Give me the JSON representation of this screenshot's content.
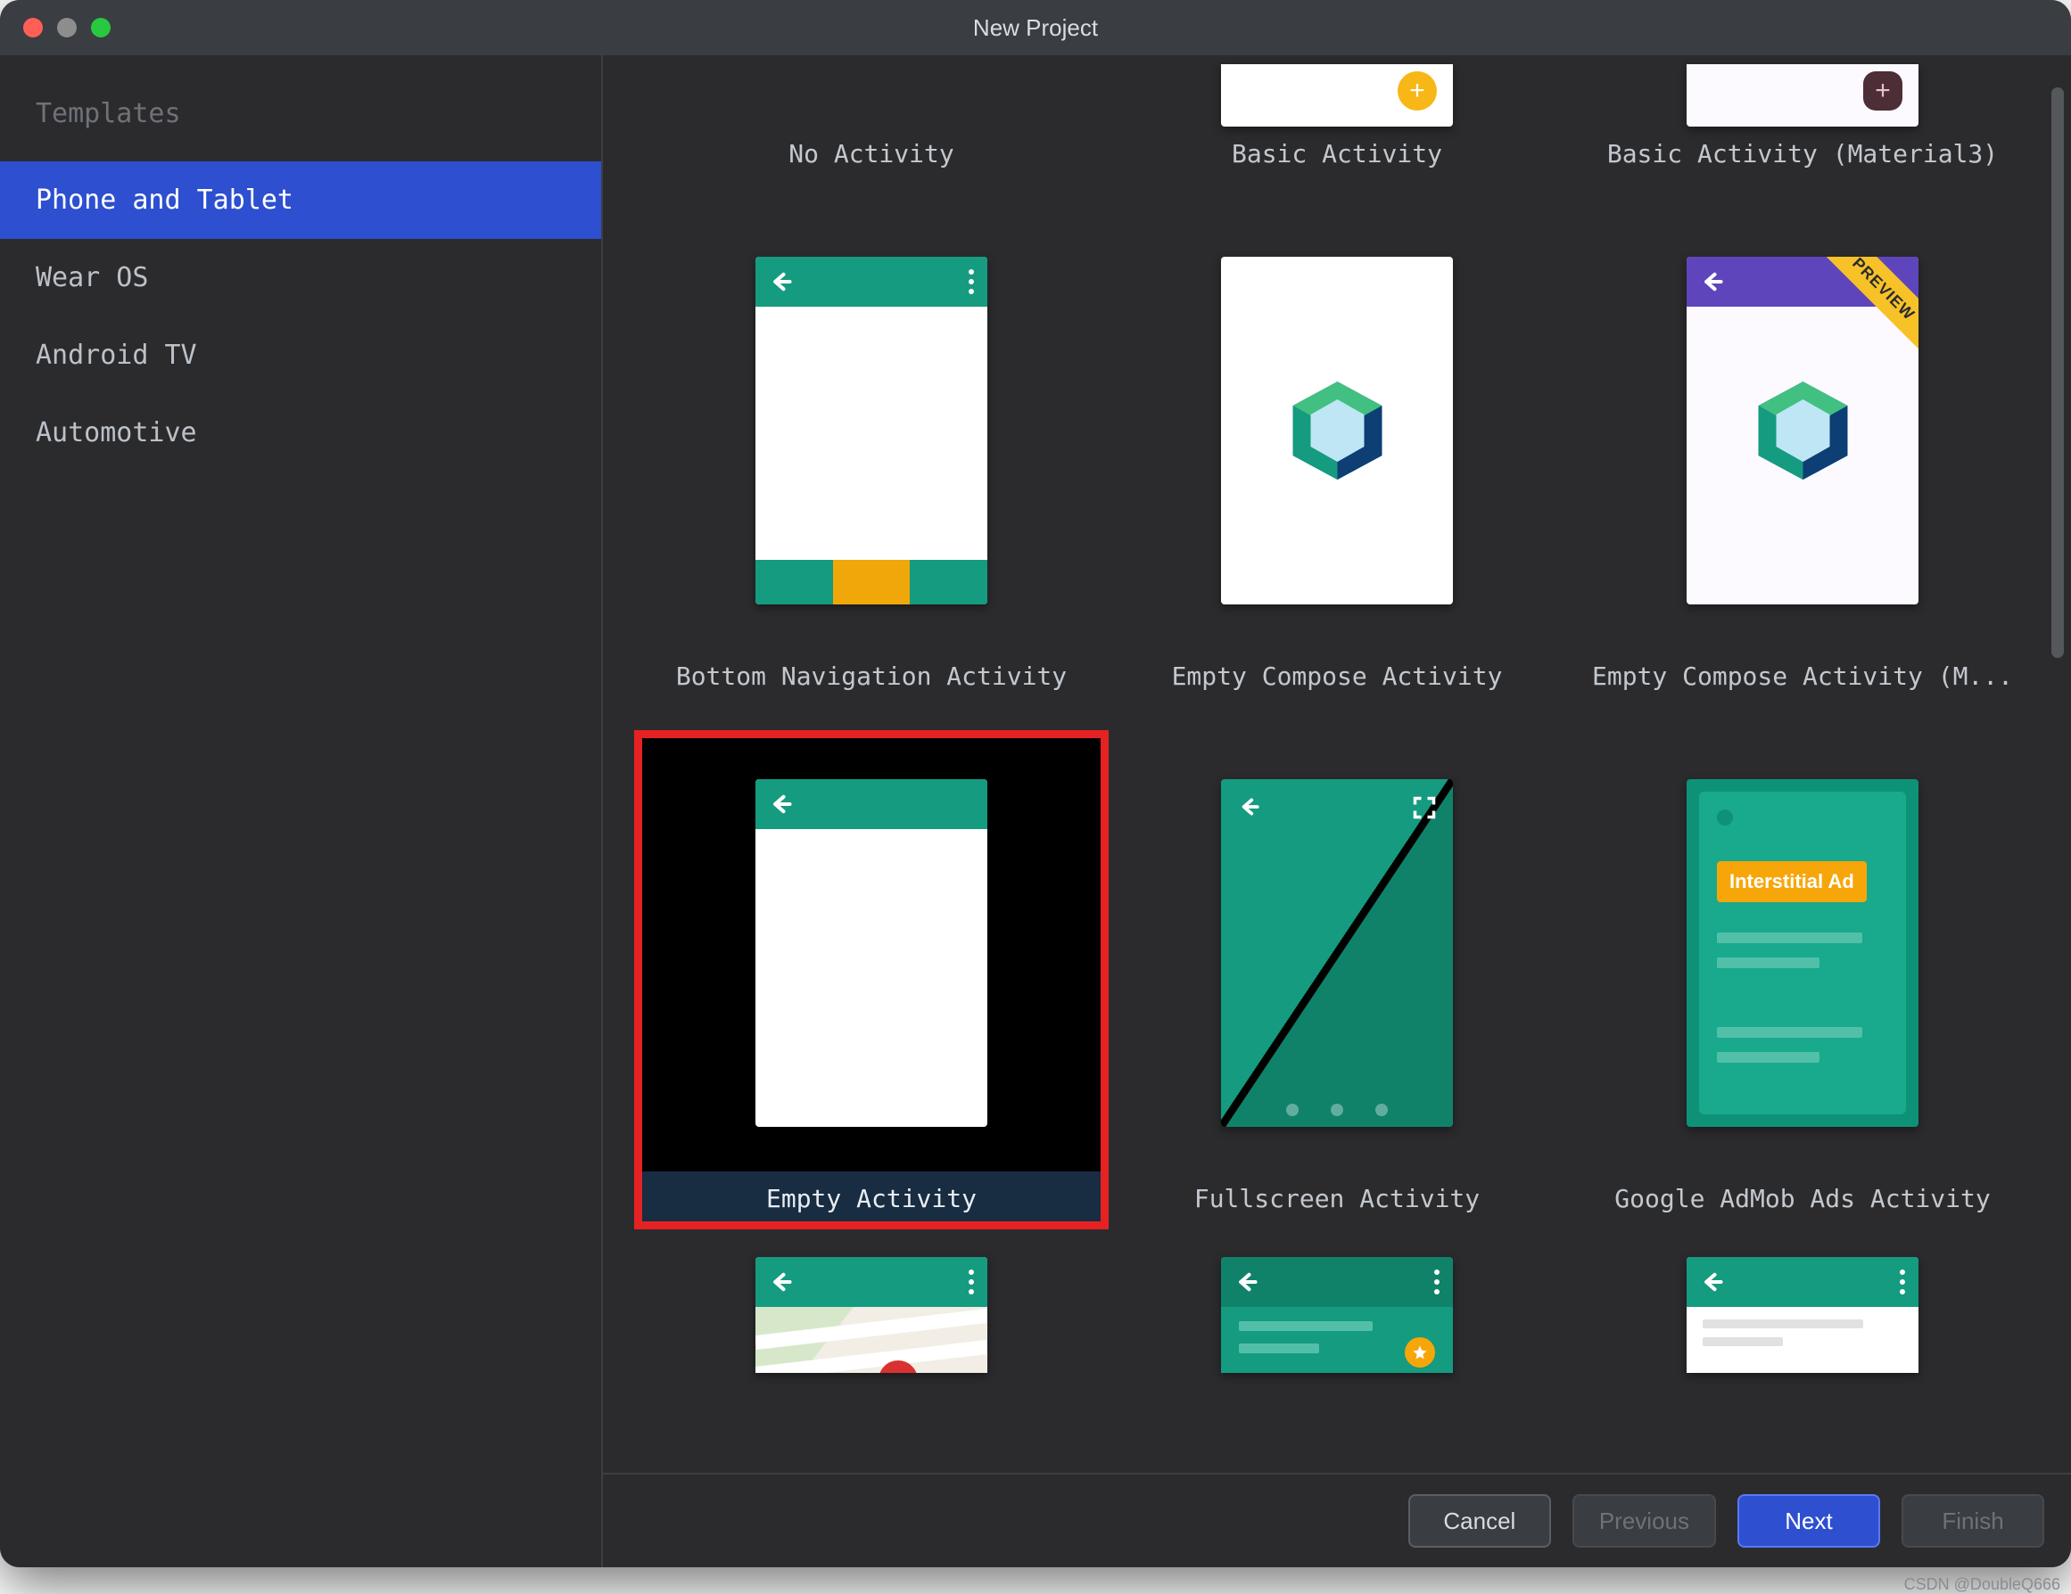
{
  "colors": {
    "accent": "#2d4fd0",
    "teal": "#159b7f",
    "purple": "#5f45bb",
    "amber": "#f0a70a",
    "highlight": "#e52222"
  },
  "window": {
    "title": "New Project"
  },
  "sidebar": {
    "header": "Templates",
    "items": [
      {
        "label": "Phone and Tablet",
        "selected": true
      },
      {
        "label": "Wear OS"
      },
      {
        "label": "Android TV"
      },
      {
        "label": "Automotive"
      }
    ]
  },
  "gallery": {
    "selected_index": 4,
    "templates": [
      {
        "label": "No Activity",
        "kind": "none"
      },
      {
        "label": "Basic Activity",
        "kind": "basic-fab-amber"
      },
      {
        "label": "Basic Activity (Material3)",
        "kind": "basic-fab-maroon"
      },
      {
        "label": "Bottom Navigation Activity",
        "kind": "bottom-nav"
      },
      {
        "label": "Empty Compose Activity",
        "kind": "compose"
      },
      {
        "label": "Empty Compose Activity (M...",
        "kind": "compose-preview"
      },
      {
        "label": "Empty Activity",
        "kind": "empty"
      },
      {
        "label": "Fullscreen Activity",
        "kind": "fullscreen"
      },
      {
        "label": "Google AdMob Ads Activity",
        "kind": "admob",
        "badge": "Interstitial Ad"
      },
      {
        "label": "",
        "kind": "maps-cut"
      },
      {
        "label": "",
        "kind": "login-cut"
      },
      {
        "label": "",
        "kind": "detail-cut"
      }
    ],
    "ribbon_text": "PREVIEW"
  },
  "footer": {
    "cancel": "Cancel",
    "previous": "Previous",
    "next": "Next",
    "finish": "Finish"
  },
  "watermark": "CSDN @DoubleQ666"
}
